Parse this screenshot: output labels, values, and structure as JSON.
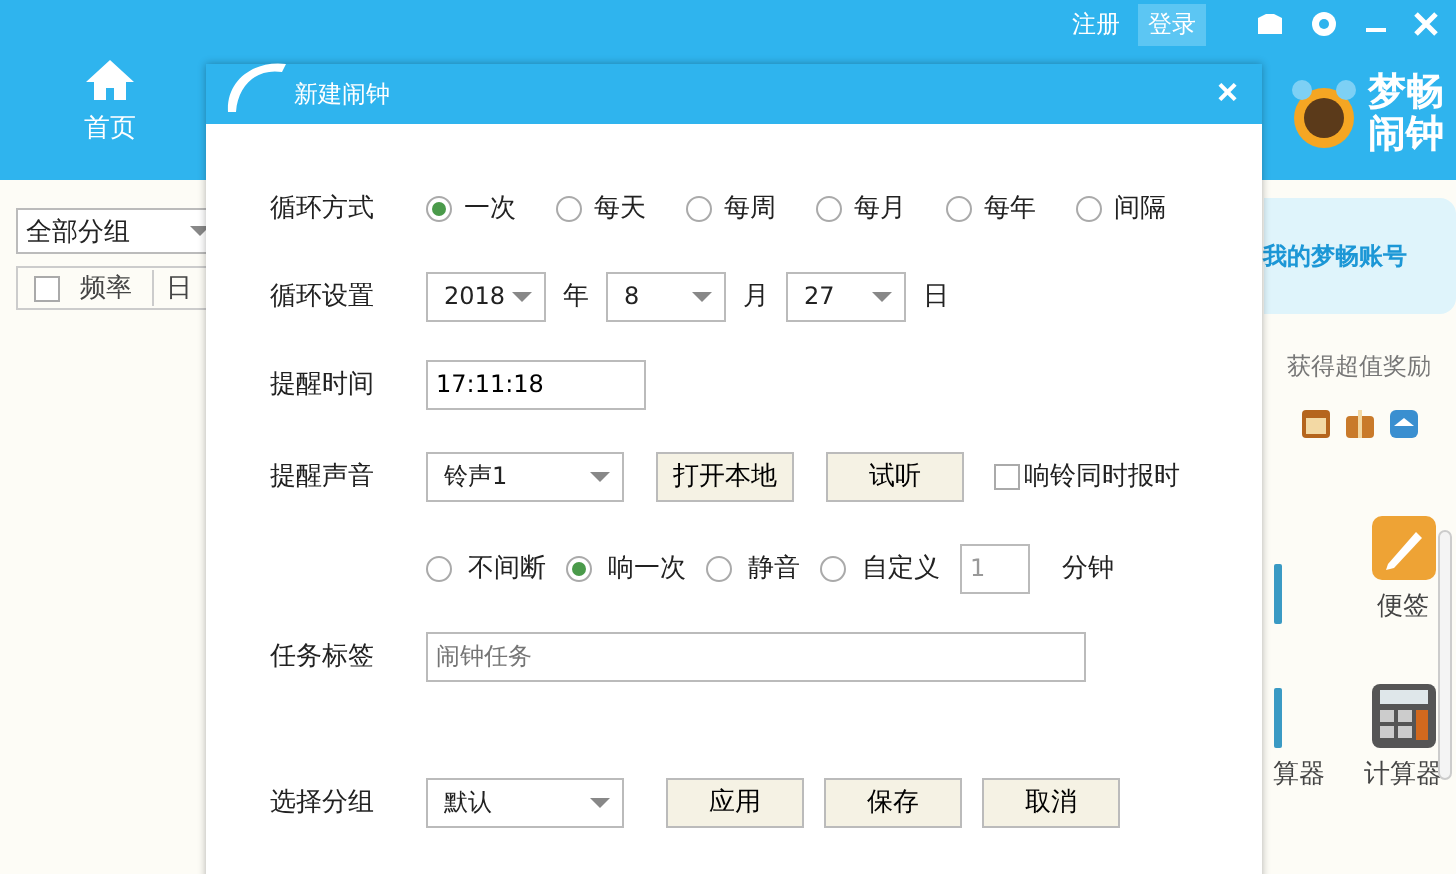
{
  "app": {
    "top_links": [
      {
        "label": "注册",
        "selected": false
      },
      {
        "label": "登录",
        "selected": true
      }
    ],
    "nav": [
      {
        "label": "首页"
      }
    ],
    "logo_lines": [
      "梦畅",
      "闹钟"
    ],
    "left": {
      "group_select": "全部分组",
      "header_checked": false,
      "columns": [
        "频率",
        "日"
      ]
    },
    "right": {
      "account": "我的梦畅账号",
      "reward": "获得超值奖励",
      "tools": [
        {
          "kind": "partial"
        },
        {
          "kind": "note",
          "label": "便签"
        },
        {
          "kind": "partial",
          "label": "算器"
        },
        {
          "kind": "calc",
          "label": "计算器"
        }
      ]
    }
  },
  "dialog": {
    "title": "新建闹钟",
    "close": "×",
    "repeat": {
      "label": "循环方式",
      "options": [
        {
          "label": "一次",
          "selected": true
        },
        {
          "label": "每天",
          "selected": false
        },
        {
          "label": "每周",
          "selected": false
        },
        {
          "label": "每月",
          "selected": false
        },
        {
          "label": "每年",
          "selected": false
        },
        {
          "label": "间隔",
          "selected": false
        }
      ]
    },
    "date": {
      "label": "循环设置",
      "selects": [
        {
          "value": "2018",
          "unit": "年"
        },
        {
          "value": "8",
          "unit": "月"
        },
        {
          "value": "27",
          "unit": "日"
        }
      ]
    },
    "time": {
      "label": "提醒时间",
      "value": "17:11:18"
    },
    "sound": {
      "label": "提醒声音",
      "select": "铃声1",
      "buttons": [
        "打开本地",
        "试听"
      ],
      "announce": {
        "label": "响铃同时报时",
        "checked": false
      }
    },
    "ring": {
      "options": [
        {
          "label": "不间断",
          "selected": false
        },
        {
          "label": "响一次",
          "selected": true
        },
        {
          "label": "静音",
          "selected": false
        },
        {
          "label": "自定义",
          "selected": false
        }
      ],
      "minutes": "1",
      "unit": "分钟"
    },
    "tag": {
      "label": "任务标签",
      "placeholder": "闹钟任务"
    },
    "group": {
      "label": "选择分组",
      "select": "默认",
      "buttons": [
        "应用",
        "保存",
        "取消"
      ]
    }
  }
}
